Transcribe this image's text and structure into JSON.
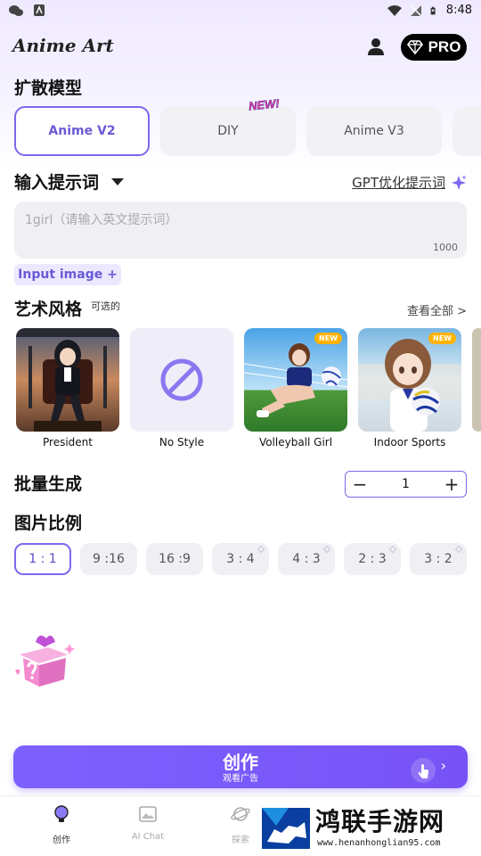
{
  "status_bar": {
    "time": "8:48"
  },
  "app": {
    "title": "Anime Art",
    "pro_label": "PRO"
  },
  "model_section": {
    "title": "扩散模型",
    "new_badge": "NEW!",
    "models": [
      {
        "label": "Anime V2",
        "selected": true
      },
      {
        "label": "DIY",
        "selected": false
      },
      {
        "label": "Anime V3",
        "selected": false
      }
    ]
  },
  "prompt": {
    "title": "输入提示词",
    "gpt_link": "GPT优化提示词",
    "placeholder": "1girl（请输入英文提示词）",
    "max_chars": "1000",
    "input_image_button": "Input image +"
  },
  "art_style": {
    "title": "艺术风格",
    "subtitle": "可选的",
    "view_all": "查看全部 >",
    "new_tag": "NEW",
    "styles": [
      {
        "label": "President",
        "is_new": false
      },
      {
        "label": "No Style",
        "is_new": false
      },
      {
        "label": "Volleyball Girl",
        "is_new": true
      },
      {
        "label": "Indoor Sports",
        "is_new": true
      }
    ]
  },
  "batch": {
    "title": "批量生成",
    "value": "1",
    "minus": "−",
    "plus": "+"
  },
  "ratio": {
    "title": "图片比例",
    "options": [
      {
        "label": "1 : 1",
        "selected": true,
        "pro": false
      },
      {
        "label": "9 :16",
        "selected": false,
        "pro": false
      },
      {
        "label": "16 :9",
        "selected": false,
        "pro": false
      },
      {
        "label": "3 : 4",
        "selected": false,
        "pro": true
      },
      {
        "label": "4 : 3",
        "selected": false,
        "pro": true
      },
      {
        "label": "2 : 3",
        "selected": false,
        "pro": true
      },
      {
        "label": "3 : 2",
        "selected": false,
        "pro": true
      }
    ]
  },
  "create_button": {
    "label": "创作",
    "sub_label": "观看广告",
    "chevron": "›"
  },
  "bottom_nav": {
    "items": [
      {
        "label": "创作",
        "icon": "bulb-icon",
        "active": true
      },
      {
        "label": "AI Chat",
        "icon": "image-icon",
        "active": false
      },
      {
        "label": "探索",
        "icon": "planet-icon",
        "active": false
      }
    ]
  },
  "watermark": {
    "title": "鸿联手游网",
    "url": "www.henanhonglian95.com"
  },
  "colors": {
    "accent": "#7b68ee",
    "button": "#7752f5",
    "chip_bg": "#f0eff4"
  }
}
